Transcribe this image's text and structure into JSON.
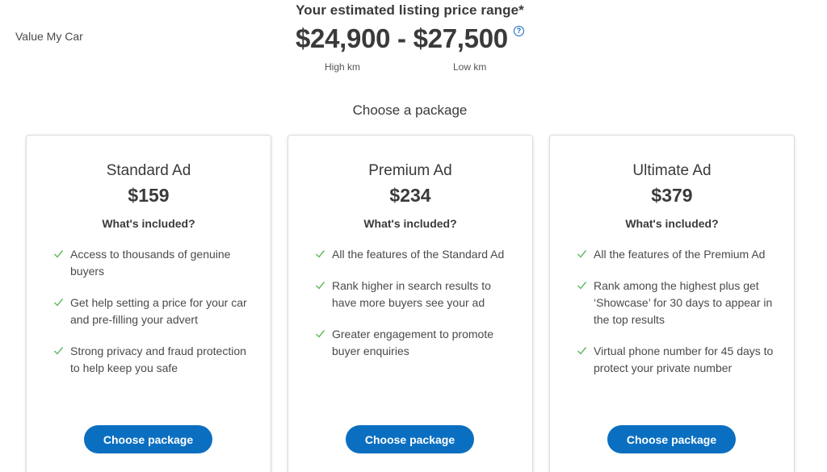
{
  "app": {
    "title": "Value My Car"
  },
  "price": {
    "heading": "Your estimated listing price range*",
    "range": "$24,900 - $27,500",
    "help_icon": "?",
    "high_label": "High km",
    "low_label": "Low km"
  },
  "packages_heading": "Choose a package",
  "packages": [
    {
      "name": "Standard Ad",
      "price": "$159",
      "included_label": "What's included?",
      "features": [
        "Access to thousands of genuine buyers",
        "Get help setting a price for your car and pre-filling your advert",
        "Strong privacy and fraud protection to help keep you safe"
      ],
      "button_label": "Choose package"
    },
    {
      "name": "Premium Ad",
      "price": "$234",
      "included_label": "What's included?",
      "features": [
        "All the features of the Standard Ad",
        "Rank higher in search results to have more buyers see your ad",
        "Greater engagement to promote buyer enquiries"
      ],
      "button_label": "Choose package"
    },
    {
      "name": "Ultimate Ad",
      "price": "$379",
      "included_label": "What's included?",
      "features": [
        "All the features of the Premium Ad",
        "Rank among the highest plus get ‘Showcase’ for 30 days to appear in the top results",
        "Virtual phone number for 45 days to protect your private number"
      ],
      "button_label": "Choose package"
    }
  ],
  "colors": {
    "accent": "#0b6fc1",
    "check": "#5cb85c",
    "text": "#3a3a3a"
  },
  "icons": {
    "help": "question-circle-icon",
    "check": "check-icon"
  }
}
